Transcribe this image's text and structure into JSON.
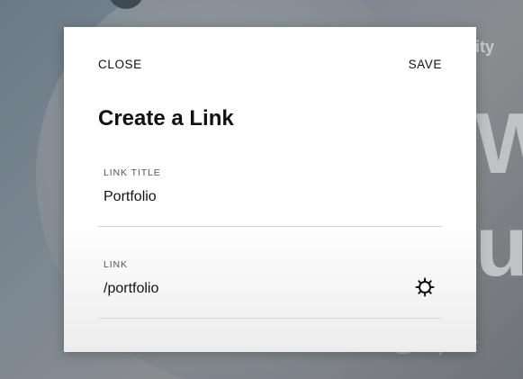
{
  "background": {
    "small_text": "ity",
    "big_text_1": "W",
    "big_text_2": "u",
    "social_icons": [
      "instagram-icon",
      "facebook-icon",
      "twitter-icon"
    ]
  },
  "dialog": {
    "close_label": "CLOSE",
    "save_label": "SAVE",
    "title": "Create a Link",
    "link_title": {
      "label": "LINK TITLE",
      "value": "Portfolio"
    },
    "link": {
      "label": "LINK",
      "value": "/portfolio",
      "settings_icon": "gear-icon"
    }
  }
}
